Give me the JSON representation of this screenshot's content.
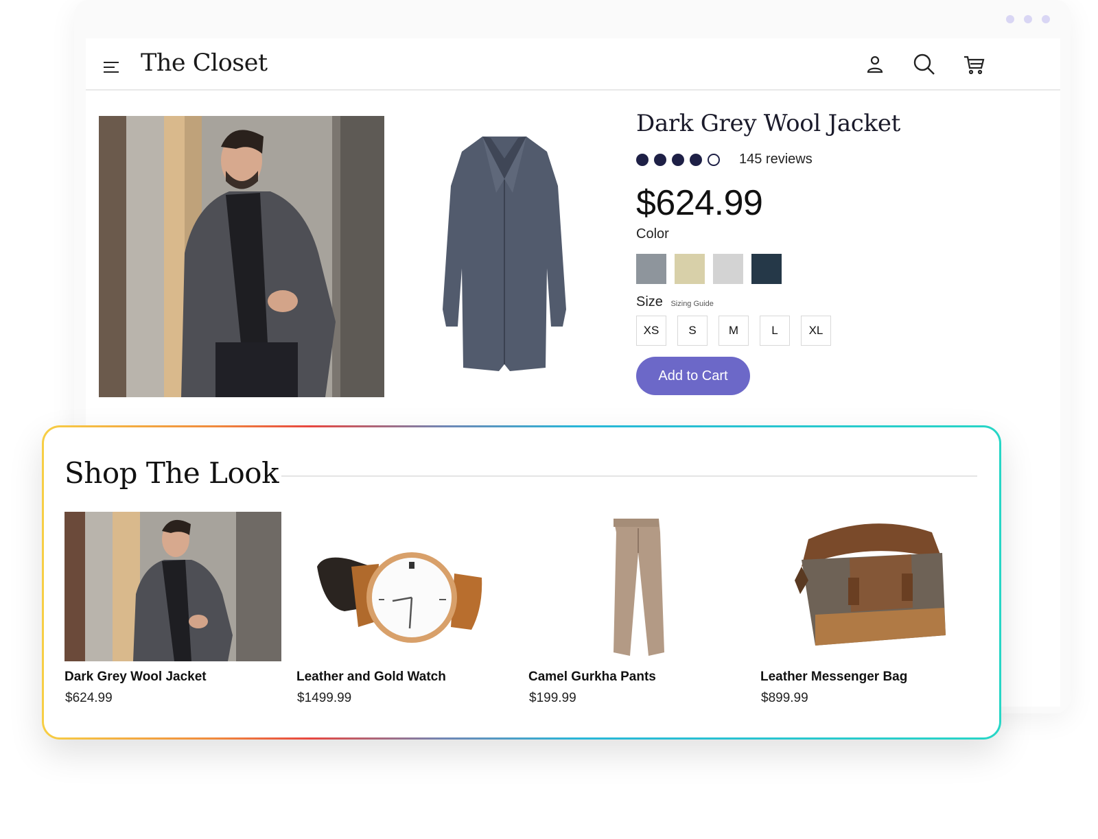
{
  "store": {
    "name": "The Closet"
  },
  "header": {
    "icons": [
      "menu-icon",
      "account-icon",
      "search-icon",
      "cart-icon"
    ]
  },
  "product": {
    "title": "Dark Grey Wool Jacket",
    "rating": {
      "filled": 4,
      "total": 5,
      "reviews_label": "145 reviews"
    },
    "price": "$624.99",
    "color_label": "Color",
    "colors": [
      "#8e959c",
      "#d8d0a9",
      "#d3d3d3",
      "#253848"
    ],
    "size_label": "Size",
    "sizing_guide": "Sizing Guide",
    "sizes": [
      "XS",
      "S",
      "M",
      "L",
      "XL"
    ],
    "add_to_cart": "Add to Cart"
  },
  "shop_the_look": {
    "title": "Shop The Look",
    "items": [
      {
        "name": "Dark Grey Wool Jacket",
        "price": "$624.99"
      },
      {
        "name": "Leather and Gold Watch",
        "price": "$1499.99"
      },
      {
        "name": "Camel Gurkha Pants",
        "price": "$199.99"
      },
      {
        "name": "Leather Messenger Bag",
        "price": "$899.99"
      }
    ]
  },
  "colors": {
    "accent": "#6c68c8",
    "rating": "#1e2046",
    "window_dots": "#d9d6f4"
  }
}
